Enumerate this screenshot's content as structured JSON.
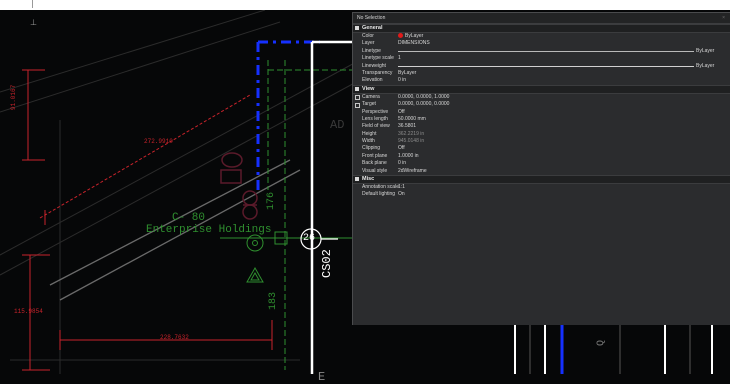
{
  "colors": {
    "background": "#060708",
    "panel": "#2b2c2e",
    "red_dims": "#c8232b",
    "green_geometry": "#2f8f2f",
    "blue_dashed": "#1530ff",
    "white_lines": "#ffffff",
    "color_swatch": "#e11a1a"
  },
  "drawing": {
    "dim_left_1": "91.0167",
    "dim_diag": "272.9910",
    "dim_left_2": "115.9854",
    "dim_bottom": "228.7632",
    "zone_text": "C-  80",
    "company_text": "Enterprise  Holdings",
    "dim_vert_1": "176",
    "dim_vert_2": "183",
    "tag_num": "26",
    "tag_code": "CS02",
    "partial_label": "AD",
    "edge_glyph": "E",
    "right_glyph": "Q",
    "upper_glyph": "⊥"
  },
  "properties": {
    "title": "No Selection",
    "close_glyph": "×",
    "sections": [
      {
        "name": "General",
        "rows": [
          {
            "label": "Color",
            "value": "ByLayer",
            "swatch": true
          },
          {
            "label": "Layer",
            "value": "DIMENSIONS"
          },
          {
            "label": "Linetype",
            "value": "ByLayer",
            "line": true
          },
          {
            "label": "Linetype scale",
            "value": "1"
          },
          {
            "label": "Lineweight",
            "value": "ByLayer",
            "line": true
          },
          {
            "label": "Transparency",
            "value": "ByLayer"
          },
          {
            "label": "Elevation",
            "value": "0 in"
          }
        ]
      },
      {
        "name": "View",
        "rows": [
          {
            "label": "Camera",
            "value": "0.0000, 0.0000, 1.0000",
            "expand": true
          },
          {
            "label": "Target",
            "value": "0.0000, 0.0000, 0.0000",
            "expand": true
          },
          {
            "label": "Perspective",
            "value": "Off"
          },
          {
            "label": "Lens length",
            "value": "50.0000 mm"
          },
          {
            "label": "Field of view",
            "value": "36.5801"
          },
          {
            "label": "Height",
            "value": "362.2219 in",
            "dim": true
          },
          {
            "label": "Width",
            "value": "945.0148 in",
            "dim": true
          },
          {
            "label": "Clipping",
            "value": "Off"
          },
          {
            "label": "Front plane",
            "value": "1.0000 in"
          },
          {
            "label": "Back plane",
            "value": "0 in"
          },
          {
            "label": "Visual style",
            "value": "2dWireframe"
          }
        ]
      },
      {
        "name": "Misc",
        "rows": [
          {
            "label": "Annotation scale",
            "value": "1:1"
          },
          {
            "label": "Default lighting",
            "value": "On"
          }
        ]
      }
    ]
  }
}
